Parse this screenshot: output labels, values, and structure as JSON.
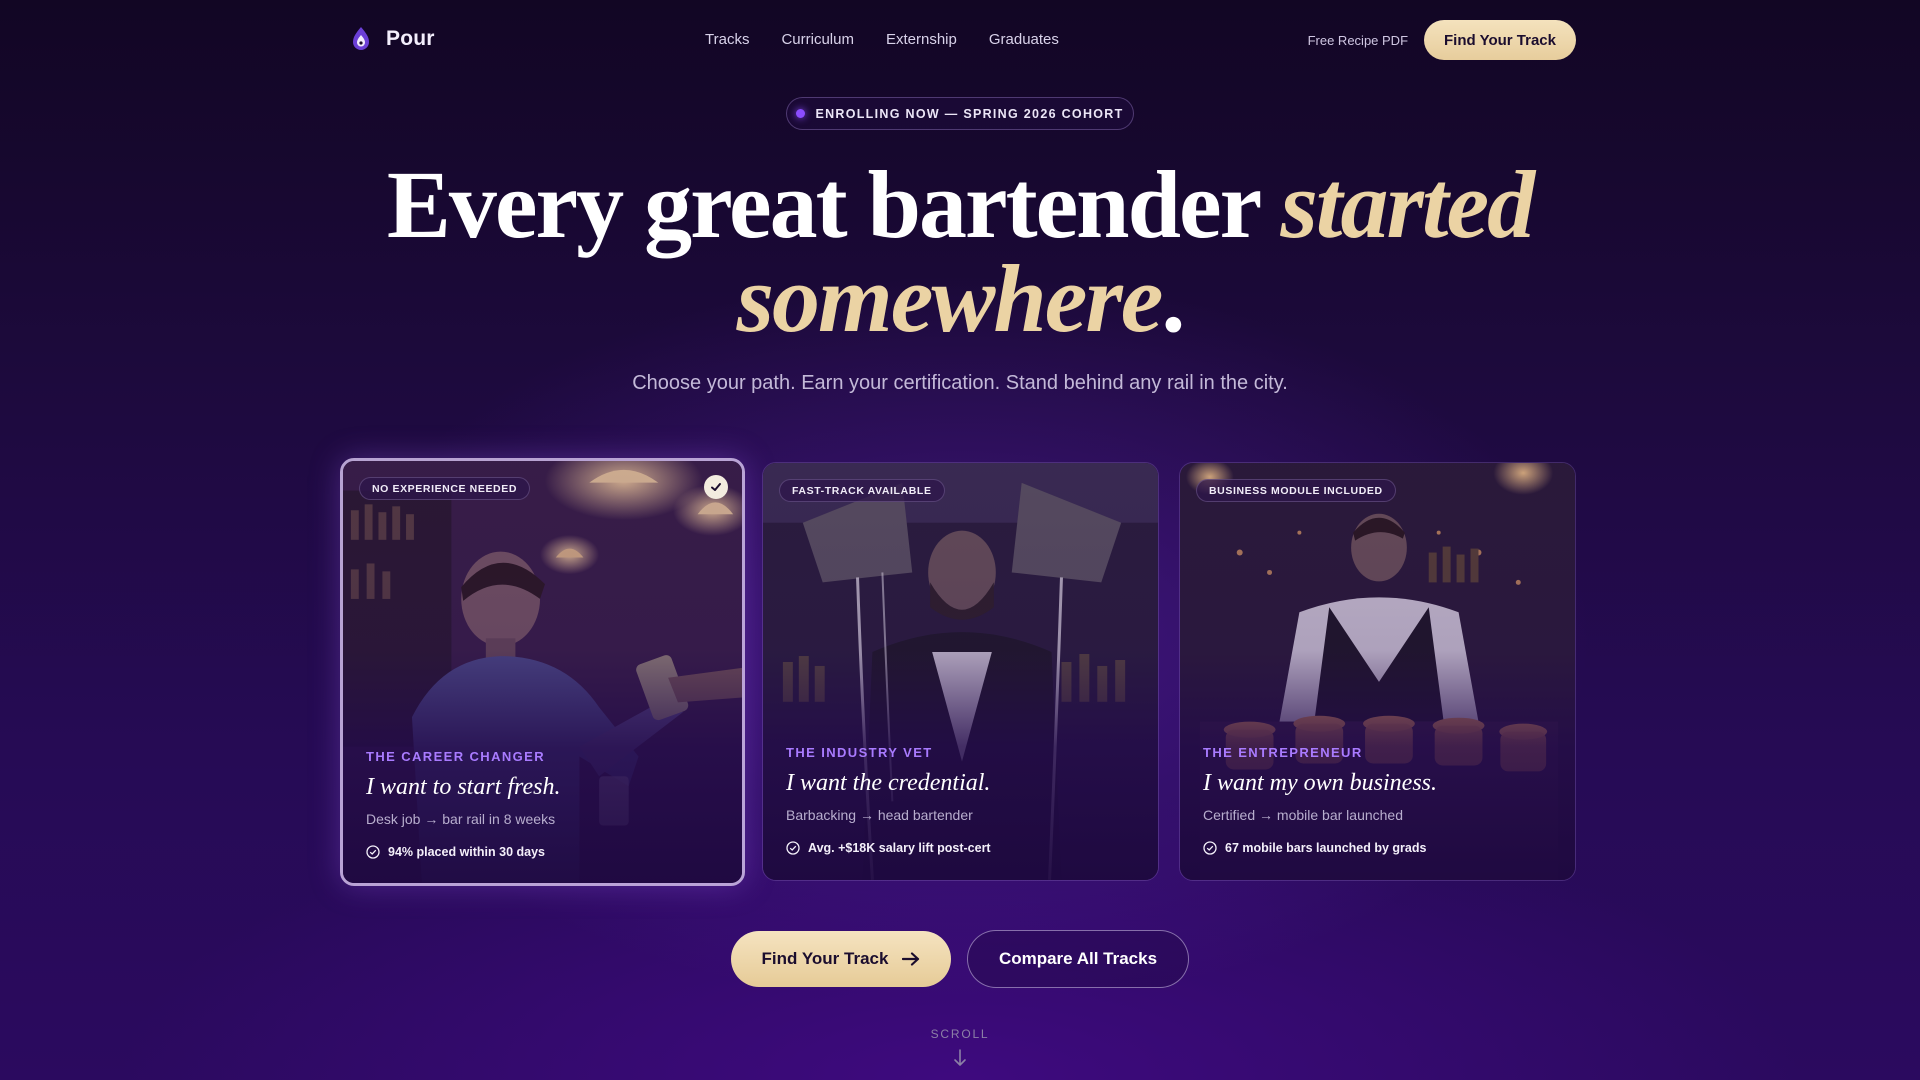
{
  "brand": {
    "name": "Pour",
    "logo_icon": "flame-drop-icon"
  },
  "nav": {
    "links": [
      "Tracks",
      "Curriculum",
      "Externship",
      "Graduates"
    ],
    "free_pdf": "Free Recipe PDF",
    "cta": "Find Your Track"
  },
  "badge": {
    "text": "ENROLLING NOW — SPRING 2026 COHORT"
  },
  "hero": {
    "line1_plain": "Every great bartender ",
    "line1_accent": "started",
    "line2_accent": "somewhere",
    "line2_end": ".",
    "subhead": "Choose your path. Earn your certification. Stand behind any rail in the city."
  },
  "cards": [
    {
      "tag": "NO EXPERIENCE NEEDED",
      "label": "THE CAREER CHANGER",
      "title": "I want to start fresh.",
      "path_from": "Desk job",
      "path_arrow": "→",
      "path_to": "bar rail in 8 weeks",
      "stat": "94% placed within 30 days",
      "selected": true
    },
    {
      "tag": "FAST-TRACK AVAILABLE",
      "label": "THE INDUSTRY VET",
      "title": "I want the credential.",
      "path_from": "Barbacking",
      "path_arrow": "→",
      "path_to": "head bartender",
      "stat": "Avg. +$18K salary lift post-cert",
      "selected": false
    },
    {
      "tag": "BUSINESS MODULE INCLUDED",
      "label": "THE ENTREPRENEUR",
      "title": "I want my own business.",
      "path_from": "Certified",
      "path_arrow": "→",
      "path_to": "mobile bar launched",
      "stat": "67 mobile bars launched by grads",
      "selected": false
    }
  ],
  "cta": {
    "primary": "Find Your Track",
    "secondary": "Compare All Tracks"
  },
  "scroll": {
    "label": "SCROLL"
  },
  "colors": {
    "accent_gold": "#ebd3a4",
    "accent_violet": "#a97bff",
    "bg_deep": "#1d0a3d"
  }
}
